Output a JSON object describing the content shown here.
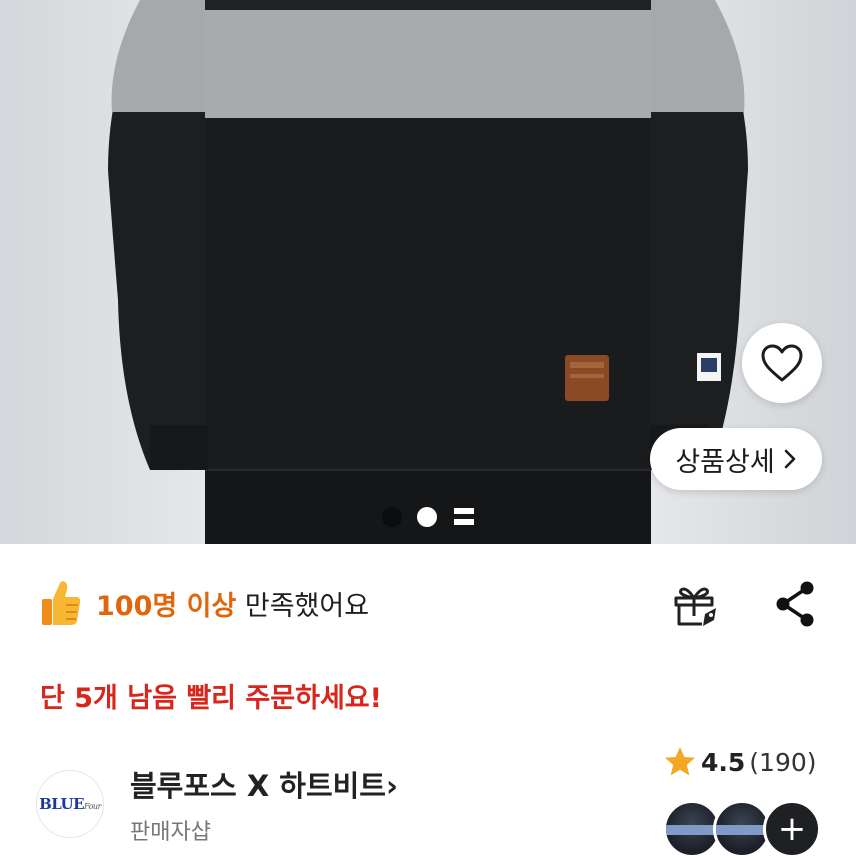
{
  "product_image": {
    "detail_button_label": "상품상세",
    "pager": {
      "total": 3,
      "active_index": 1
    }
  },
  "satisfaction": {
    "highlight": "100명 이상",
    "suffix": " 만족했어요"
  },
  "stock_alert": "단 5개 남음 빨리 주문하세요!",
  "seller": {
    "logo_text": "BLUE",
    "logo_script": "Four",
    "name": "블루포스 X 하트비트",
    "chevron": "›",
    "type": "판매자샵"
  },
  "rating": {
    "score": "4.5",
    "count": "(190)"
  },
  "reviewers": {
    "more_label": "+"
  },
  "colors": {
    "highlight_orange": "#e0660d",
    "alert_red": "#d8261c",
    "star": "#f5a623"
  },
  "icons": [
    "heart-icon",
    "chevron-right-icon",
    "thumbs-up-icon",
    "gift-icon",
    "share-icon",
    "star-icon",
    "plus-icon"
  ]
}
